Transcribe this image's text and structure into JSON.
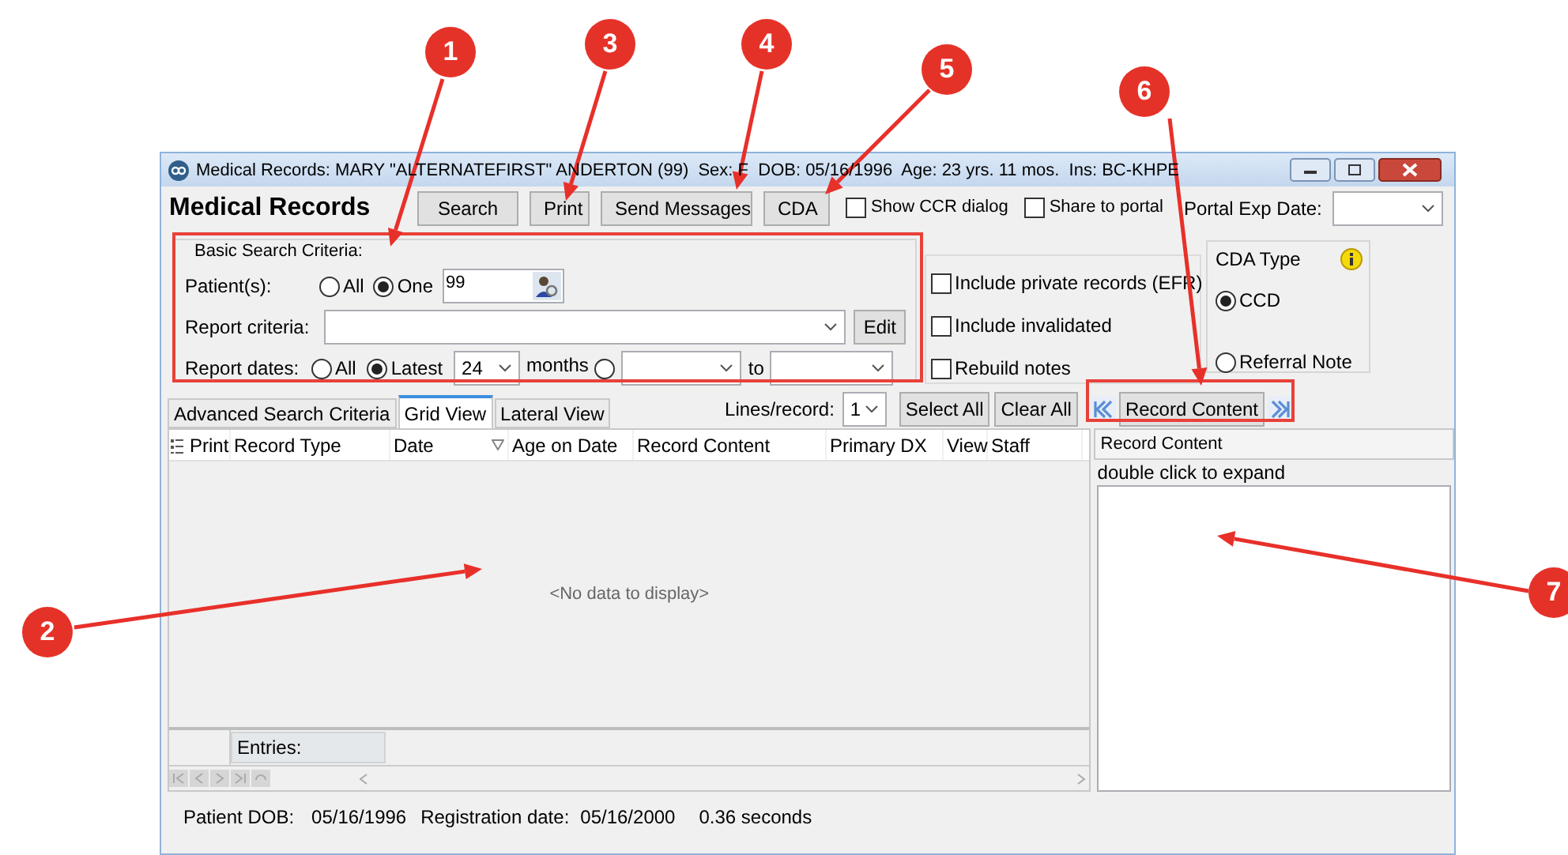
{
  "callouts": [
    {
      "number": "1"
    },
    {
      "number": "2"
    },
    {
      "number": "3"
    },
    {
      "number": "4"
    },
    {
      "number": "5"
    },
    {
      "number": "6"
    },
    {
      "number": "7"
    }
  ],
  "window": {
    "title": "Medical Records: MARY \"ALTERNATEFIRST\" ANDERTON (99)  Sex: F  DOB: 05/16/1996  Age: 23 yrs. 11 mos.  Ins: BC-KHPE"
  },
  "header": {
    "title": "Medical Records",
    "buttons": [
      "Search",
      "Print",
      "Send Messages",
      "CDA"
    ],
    "checkboxes": [
      {
        "label": "Show CCR dialog",
        "checked": false
      },
      {
        "label": "Share to portal",
        "checked": false
      }
    ],
    "portal_exp_date": {
      "label": "Portal Exp Date:"
    }
  },
  "basic_search": {
    "title": "Basic Search Criteria:",
    "patients": {
      "label": "Patient(s):",
      "options": [
        {
          "label": "All",
          "selected": false
        },
        {
          "label": "One",
          "selected": true
        }
      ],
      "value": "99"
    },
    "report_criteria": {
      "label": "Report criteria:",
      "button": "Edit"
    },
    "report_dates": {
      "label": "Report dates:",
      "options": [
        {
          "label": "All",
          "selected": false
        },
        {
          "label": "Latest",
          "selected": true
        }
      ],
      "months": "24",
      "months_label": "months",
      "range_selected": false,
      "to_label": "to"
    }
  },
  "options": [
    {
      "label": "Include private records (EFR)",
      "checked": false
    },
    {
      "label": "Include invalidated",
      "checked": false
    },
    {
      "label": "Rebuild notes",
      "checked": false
    }
  ],
  "cda_type": {
    "title": "CDA Type",
    "options": [
      {
        "label": "CCD",
        "selected": true
      },
      {
        "label": "Referral Note",
        "selected": false
      }
    ]
  },
  "tabs": [
    {
      "label": "Advanced Search Criteria",
      "selected": false
    },
    {
      "label": "Grid View",
      "selected": true
    },
    {
      "label": "Lateral View",
      "selected": false
    }
  ],
  "lines_per_record": {
    "label": "Lines/record:",
    "value": "1"
  },
  "grid_buttons": [
    "Select All",
    "Clear All"
  ],
  "record_nav": {
    "label": "Record Content"
  },
  "grid": {
    "columns": [
      "Print",
      "Record Type",
      "Date",
      "Age on Date",
      "Record Content",
      "Primary DX",
      "View",
      "Staff"
    ],
    "empty_text": "<No data to display>",
    "footer": "Entries:"
  },
  "record_panel": {
    "header": "Record Content",
    "hint": "double click to expand"
  },
  "status_bar": [
    "Patient DOB:",
    "05/16/1996",
    "Registration date:",
    "05/16/2000",
    "0.36 seconds"
  ]
}
